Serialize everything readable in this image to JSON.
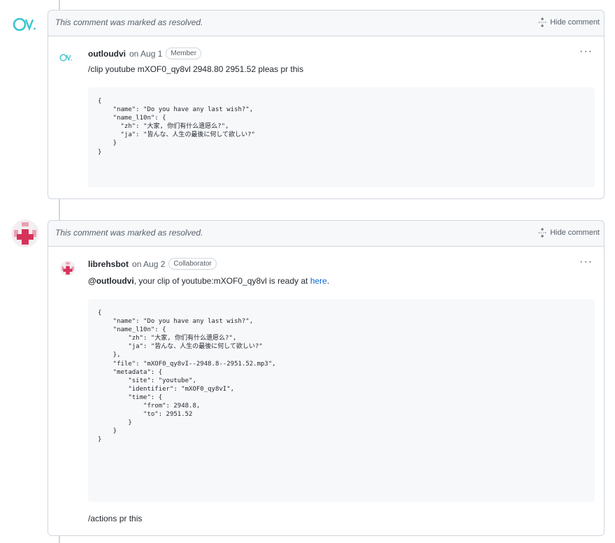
{
  "comments": [
    {
      "resolved_text": "This comment was marked as resolved.",
      "hide_label": "Hide comment",
      "author": "outloudvi",
      "date_text": "on Aug 1",
      "role_badge": "Member",
      "body": "/clip youtube mXOF0_qy8vl 2948.80 2951.52 pleas pr this",
      "code": "{\n    \"name\": \"Do you have any last wish?\",\n    \"name_l10n\": {\n      \"zh\": \"大家, 你们有什么遗愿么?\",\n      \"ja\": \"皆んな、人生の最後に何して欲しい?\"\n    }\n}"
    },
    {
      "resolved_text": "This comment was marked as resolved.",
      "hide_label": "Hide comment",
      "author": "librehsbot",
      "date_text": "on Aug 2",
      "role_badge": "Collaborator",
      "mention": "@outloudvi",
      "body_middle": ", your clip of youtube:mXOF0_qy8vl is ready at ",
      "link_text": "here",
      "body_end": ".",
      "code": "{\n    \"name\": \"Do you have any last wish?\",\n    \"name_l10n\": {\n        \"zh\": \"大家, 你们有什么遗愿么?\",\n        \"ja\": \"皆んな、人生の最後に何して欲しい?\"\n    },\n    \"file\": \"mXOF0_qy8vI--2948.8--2951.52.mp3\",\n    \"metadata\": {\n        \"site\": \"youtube\",\n        \"identifier\": \"mXOF0_qy8vI\",\n        \"time\": {\n            \"from\": 2948.8,\n            \"to\": 2951.52\n        }\n    }\n}",
      "footer": "/actions pr this"
    }
  ],
  "colors": {
    "accent_cyan": "#39c5cf",
    "bot_avatar_pink": "#e8a0b4",
    "bot_avatar_red": "#d6335b",
    "link_blue": "#0969da"
  },
  "icons": [
    "ov-logo-icon",
    "bot-avatar-icon",
    "unfold-icon",
    "kebab-icon"
  ]
}
